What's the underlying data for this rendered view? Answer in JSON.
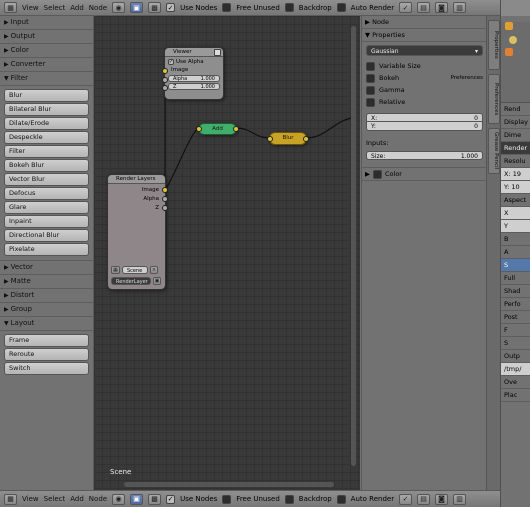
{
  "top_header": {
    "menus": [
      "View",
      "Select",
      "Add",
      "Node"
    ],
    "use_nodes": "Use Nodes",
    "free_unused": "Free Unused",
    "backdrop": "Backdrop",
    "auto_render": "Auto Render"
  },
  "bottom_header": {
    "menus": [
      "View",
      "Select",
      "Add",
      "Node"
    ],
    "use_nodes": "Use Nodes",
    "free_unused": "Free Unused",
    "backdrop": "Backdrop",
    "auto_render": "Auto Render"
  },
  "toolbox": {
    "sections_top": [
      "Input",
      "Output",
      "Color",
      "Converter"
    ],
    "filter_label": "Filter",
    "filter_items": [
      "Blur",
      "Bilateral Blur",
      "Dilate/Erode",
      "Despeckle",
      "Filter",
      "Bokeh Blur",
      "Vector Blur",
      "Defocus",
      "Glare",
      "Inpaint",
      "Directional Blur",
      "Pixelate"
    ],
    "sections_mid": [
      "Vector",
      "Matte",
      "Distort",
      "Group"
    ],
    "layout_label": "Layout",
    "layout_items": [
      "Frame",
      "Reroute",
      "Switch"
    ]
  },
  "nodes": {
    "viewer": {
      "title": "Viewer",
      "use_alpha": "Use Alpha",
      "image": "Image",
      "alpha": "Alpha",
      "alpha_value": "1.000",
      "z": "Z",
      "z_value": "1.000"
    },
    "render_layers": {
      "title": "Render Layers",
      "image": "Image",
      "alpha": "Alpha",
      "z": "Z",
      "scene": "Scene",
      "layer": "RenderLayer"
    },
    "add": {
      "title": "Add"
    },
    "blur": {
      "title": "Blur"
    }
  },
  "editor_label": "Scene",
  "properties_panel": {
    "node_label": "Node",
    "properties_label": "Properties",
    "filter_type": "Gaussian",
    "variable_size": "Variable Size",
    "bokeh": "Bokeh",
    "preferences_tooltip": "Preferences",
    "gamma": "Gamma",
    "relative": "Relative",
    "x_label": "X:",
    "x_value": "0",
    "y_label": "Y:",
    "y_value": "0",
    "inputs_label": "Inputs:",
    "size_label": "Size:",
    "size_value": "1.000",
    "color_label": "Color"
  },
  "side_tabs": [
    "Properties",
    "Preferences",
    "Grease Pencil"
  ],
  "right_panel": {
    "rows": [
      "Rend",
      "Display",
      "Dime",
      "Render",
      "Resolu",
      "X: 19",
      "Y: 10",
      "Aspect",
      "X",
      "Y",
      "B",
      "A",
      "S",
      "Full",
      "Shad",
      "Perfo",
      "Post",
      "F",
      "S",
      "Outp",
      "/tmp/",
      "Ove",
      "Plac"
    ]
  },
  "colors": {
    "add_node": "#3fae6a",
    "blur_node": "#c8a224",
    "node_body": "#8e8e8e",
    "editor_bg": "#393939",
    "active_button": "#5577aa"
  }
}
